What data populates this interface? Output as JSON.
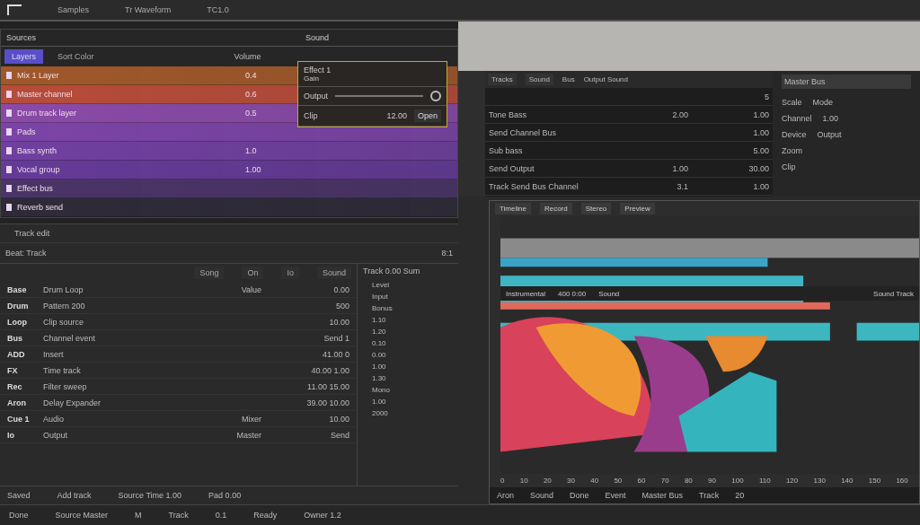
{
  "top_bar": {
    "items": [
      "Samples",
      "Tr Waveform",
      "TC1.0"
    ]
  },
  "layers_panel": {
    "title": "Sources",
    "header": "Sound",
    "tabs": [
      {
        "label": "Layers",
        "selected": true
      },
      {
        "label": "Sort Color",
        "selected": false
      }
    ],
    "column": "Volume",
    "rows": [
      {
        "name": "Mix 1 Layer",
        "value": "0.4",
        "color": "#a0582a"
      },
      {
        "name": "Master channel",
        "value": "0.6",
        "color": "#b84c3a"
      },
      {
        "name": "Drum track layer",
        "value": "0.5",
        "color": "#8a4aa8"
      },
      {
        "name": "Pads",
        "value": "",
        "color": "#7c44a8"
      },
      {
        "name": "Bass synth",
        "value": "1.0",
        "color": "#7040a0"
      },
      {
        "name": "Vocal group",
        "value": "1.00",
        "color": "#653a98"
      },
      {
        "name": "Effect bus",
        "value": "",
        "color": "#4a3468"
      },
      {
        "name": "Reverb send",
        "value": "",
        "color": "#2e2a38"
      }
    ]
  },
  "sound_popup": {
    "title": "Effect 1",
    "subtitle": "Gain",
    "field": "Output",
    "rows": [
      {
        "label": "Clip",
        "value": "12.00",
        "extra": "Open"
      }
    ]
  },
  "track_panel": {
    "title": "Track edit",
    "subtitle": "Beat: Track",
    "badge": "8:1",
    "toolbar": [
      "Song",
      "On",
      "Io",
      "Sound"
    ],
    "rows": [
      {
        "key": "Base",
        "name": "Drum Loop",
        "value": "0.00",
        "extra": "Value"
      },
      {
        "key": "Drum",
        "name": "Pattern 200",
        "value": "500",
        "extra": ""
      },
      {
        "key": "Loop",
        "name": "Clip source",
        "value": "10.00",
        "extra": ""
      },
      {
        "key": "Bus",
        "name": "Channel event",
        "value": "Send 1",
        "extra": ""
      },
      {
        "key": "ADD",
        "name": "Insert",
        "value": "41.00 0",
        "extra": ""
      },
      {
        "key": "FX",
        "name": "Time track",
        "value": "40.00 1.00",
        "extra": ""
      },
      {
        "key": "Rec",
        "name": "Filter sweep",
        "value": "11.00 15.00",
        "extra": ""
      },
      {
        "key": "Aron",
        "name": "Delay Expander",
        "value": "39.00 10.00",
        "extra": ""
      },
      {
        "key": "Cue 1",
        "name": "Audio",
        "value": "10.00",
        "extra": "Mixer"
      },
      {
        "key": "Io",
        "name": "Output",
        "value": "Send",
        "extra": "Master"
      }
    ],
    "side_header": "Track 0.00 Sum",
    "side_values": [
      "Level",
      "Input",
      "Bonus",
      "1.10",
      "1.20",
      "0.10",
      "0.00",
      "1.00",
      "1.30",
      "Mono",
      "1.00",
      "2000"
    ],
    "footer": [
      "Saved",
      "Add track",
      "Source Time 1.00",
      "Pad 0.00"
    ]
  },
  "mixer_panel": {
    "tabs": [
      "Tracks",
      "Sound"
    ],
    "label": "Bus",
    "sub": "Output Sound",
    "rows": [
      {
        "name": "",
        "a": "",
        "b": "5"
      },
      {
        "name": "Tone Bass",
        "a": "2.00",
        "b": "1.00"
      },
      {
        "name": "Send Channel Bus",
        "a": "",
        "b": "1.00"
      },
      {
        "name": "Sub bass",
        "a": "",
        "b": "5.00"
      },
      {
        "name": "Send Output",
        "a": "1.00",
        "b": "30.00"
      },
      {
        "name": "Track Send Bus Channel",
        "a": "3.1",
        "b": "1.00"
      }
    ]
  },
  "inspector": {
    "title": "Master Bus",
    "rows": [
      {
        "label": "Scale",
        "value": "Mode"
      },
      {
        "label": "Channel",
        "value": "1.00"
      },
      {
        "label": "Device",
        "value": "Output"
      },
      {
        "label": "Zoom",
        "value": ""
      },
      {
        "label": "Clip",
        "value": ""
      }
    ]
  },
  "viewer": {
    "tabs": [
      "Timeline",
      "Record",
      "Stereo",
      "Preview"
    ],
    "overlay": [
      "Instrumental",
      "400 0:00",
      "Sound"
    ],
    "overlay_right": "Sound Track",
    "x_labels": [
      "0",
      "10",
      "20",
      "30",
      "40",
      "50",
      "60",
      "70",
      "80",
      "90",
      "100",
      "110",
      "120",
      "130",
      "140",
      "150",
      "160"
    ],
    "footer": [
      "Aron",
      "Sound",
      "Done",
      "Event",
      "Master Bus",
      "Track",
      "20"
    ]
  },
  "status_bar": {
    "items": [
      "Done",
      "Source Master",
      "M",
      "Track",
      "0.1",
      "Ready",
      "Owner 1.2"
    ]
  }
}
